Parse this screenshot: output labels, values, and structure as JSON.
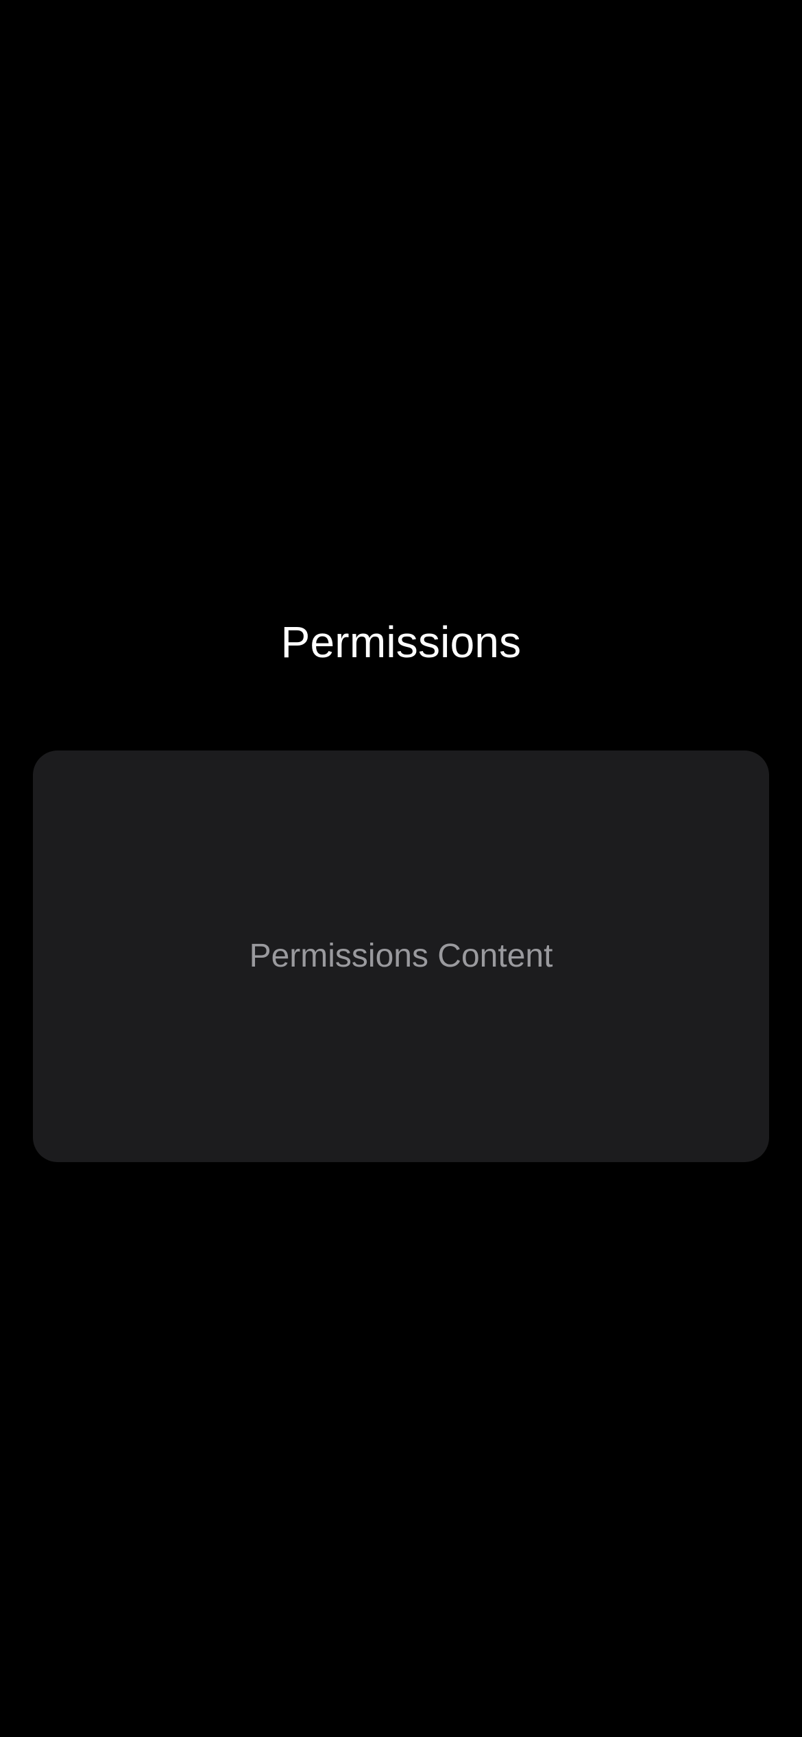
{
  "page": {
    "title": "Permissions"
  },
  "content": {
    "placeholder_text": "Permissions Content"
  },
  "colors": {
    "background": "#000000",
    "card": "#1c1c1e",
    "title_text": "#ffffff",
    "secondary_text": "#9a9a9e"
  }
}
